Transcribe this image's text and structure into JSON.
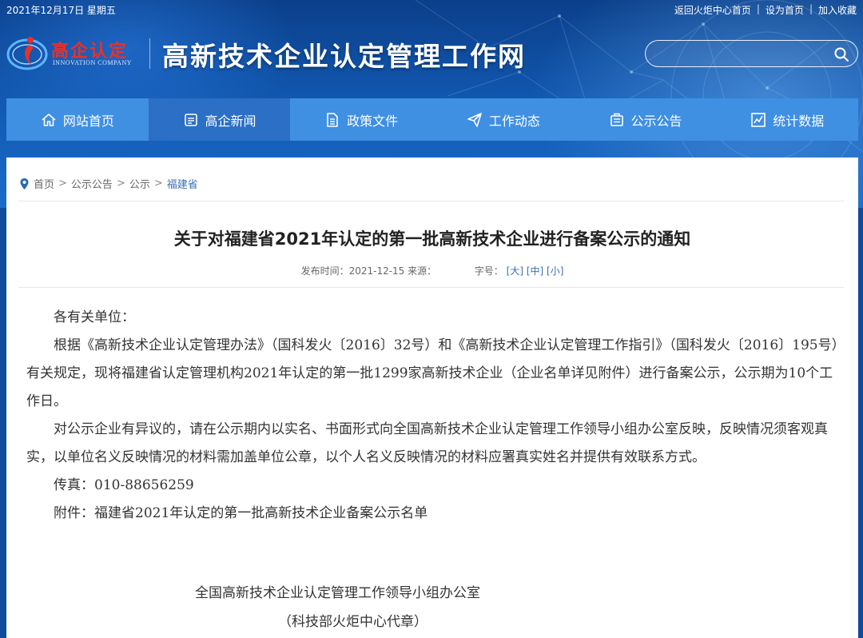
{
  "topbar": {
    "date": "2021年12月17日 星期五",
    "links": [
      "返回火炬中心首页",
      "设为首页",
      "加入收藏"
    ]
  },
  "logo": {
    "cn": "高企认定",
    "en": "INNOVATION COMPANY"
  },
  "site_title": "高新技术企业认定管理工作网",
  "search": {
    "placeholder": ""
  },
  "nav": [
    {
      "label": "网站首页",
      "icon": "home-icon"
    },
    {
      "label": "高企新闻",
      "icon": "news-icon",
      "active": true
    },
    {
      "label": "政策文件",
      "icon": "document-icon"
    },
    {
      "label": "工作动态",
      "icon": "paper-plane-icon"
    },
    {
      "label": "公示公告",
      "icon": "notice-board-icon"
    },
    {
      "label": "统计数据",
      "icon": "chart-icon"
    }
  ],
  "breadcrumb": [
    "首页",
    "公示公告",
    "公示",
    "福建省"
  ],
  "article": {
    "title": "关于对福建省2021年认定的第一批高新技术企业进行备案公示的通知",
    "publish_label": "发布时间：2021-12-15 来源：",
    "fontsize_label": "字号：",
    "fontsize_options": [
      "[大]",
      "[中]",
      "[小]"
    ],
    "salutation": "各有关单位：",
    "paragraph1": "根据《高新技术企业认定管理办法》（国科发火〔2016〕32号）和《高新技术企业认定管理工作指引》（国科发火〔2016〕195号）有关规定，现将福建省认定管理机构2021年认定的第一批1299家高新技术企业（企业名单详见附件）进行备案公示，公示期为10个工作日。",
    "paragraph2": "对公示企业有异议的，请在公示期内以实名、书面形式向全国高新技术企业认定管理工作领导小组办公室反映，反映情况须客观真实，以单位名义反映情况的材料需加盖单位公章，以个人名义反映情况的材料应署真实姓名并提供有效联系方式。",
    "fax": "传真：010-88656259",
    "attachment": "附件：福建省2021年认定的第一批高新技术企业备案公示名单",
    "signature_org": "全国高新技术企业认定管理工作领导小组办公室",
    "signature_sub": "（科技部火炬中心代章）"
  }
}
